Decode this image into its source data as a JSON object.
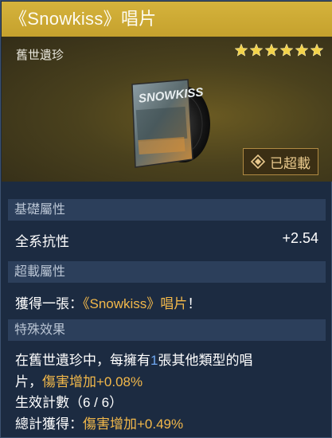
{
  "item": {
    "title": "《Snowkiss》唱片",
    "rarity": "舊世遺珍",
    "star_count": 6,
    "badge_label": "已超載"
  },
  "sections": {
    "base_stats": {
      "header": "基礎屬性",
      "stat_name": "全系抗性",
      "stat_value": "+2.54"
    },
    "overload_stats": {
      "header": "超載屬性",
      "prefix": "獲得一張：",
      "highlight": "《Snowkiss》唱片",
      "suffix": "！"
    },
    "special_effect": {
      "header": "特殊效果",
      "line1_a": "在舊世遺珍中，每擁有",
      "line1_num": "1",
      "line1_b": "張其他類型的唱",
      "line2_a": "片，",
      "line2_gold": "傷害增加+0.08%",
      "line3": "生效計數（6 / 6）",
      "line4_a": "總計獲得：",
      "line4_gold": "傷害增加+0.49%"
    }
  },
  "colors": {
    "header_gold": "#c9a52f",
    "accent_gold": "#f2b84a",
    "accent_blue": "#6fa7f0",
    "section_bg": "#2c3f5b",
    "panel_bg": "#1c2b41"
  },
  "icons": [
    "star-icon",
    "overload-icon"
  ]
}
